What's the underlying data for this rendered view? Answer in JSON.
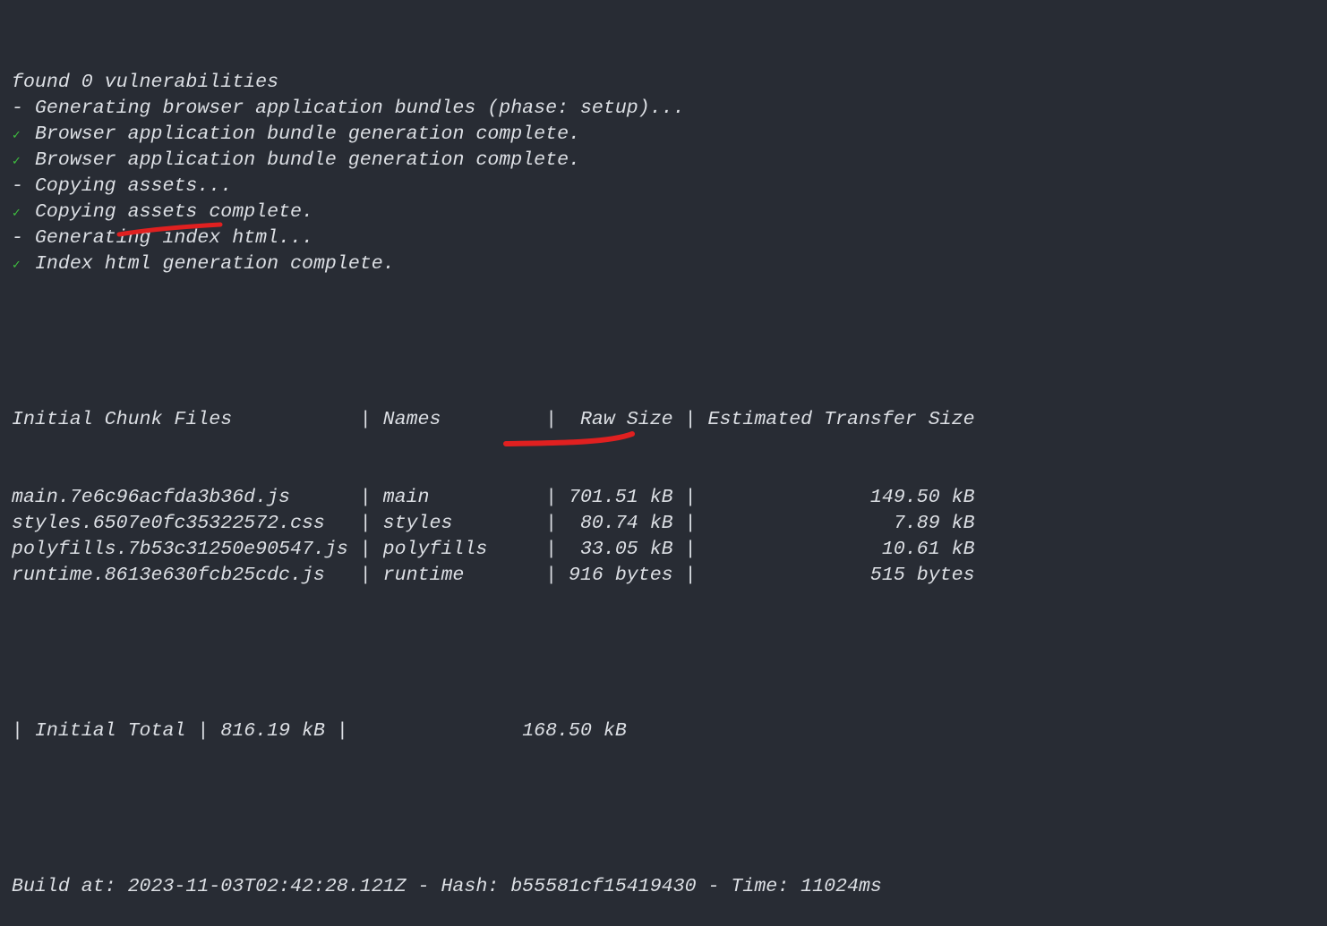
{
  "log_lines": [
    {
      "prefix": "",
      "text": "found 0 vulnerabilities"
    },
    {
      "prefix": "- ",
      "text": "Generating browser application bundles (phase: setup)..."
    },
    {
      "prefix": "check",
      "text": "Browser application bundle generation complete."
    },
    {
      "prefix": "check",
      "text": "Browser application bundle generation complete."
    },
    {
      "prefix": "- ",
      "text": "Copying assets..."
    },
    {
      "prefix": "check",
      "text": "Copying assets complete."
    },
    {
      "prefix": "- ",
      "text": "Generating index html..."
    },
    {
      "prefix": "check",
      "text": "Index html generation complete."
    }
  ],
  "check_glyph": "✓",
  "table": {
    "headers": [
      "Initial Chunk Files",
      "Names",
      "Raw Size",
      "Estimated Transfer Size"
    ],
    "rows": [
      [
        "main.7e6c96acfda3b36d.js",
        "main",
        "701.51 kB",
        "149.50 kB"
      ],
      [
        "styles.6507e0fc35322572.css",
        "styles",
        "80.74 kB",
        "7.89 kB"
      ],
      [
        "polyfills.7b53c31250e90547.js",
        "polyfills",
        "33.05 kB",
        "10.61 kB"
      ],
      [
        "runtime.8613e630fcb25cdc.js",
        "runtime",
        "916 bytes",
        "515 bytes"
      ]
    ],
    "total": {
      "label": "Initial Total",
      "raw": "816.19 kB",
      "transfer": "168.50 kB"
    }
  },
  "build_line": "Build at: 2023-11-03T02:42:28.121Z - Hash: b55581cf15419430 - Time: 11024ms",
  "annotation_color": "#e02020"
}
